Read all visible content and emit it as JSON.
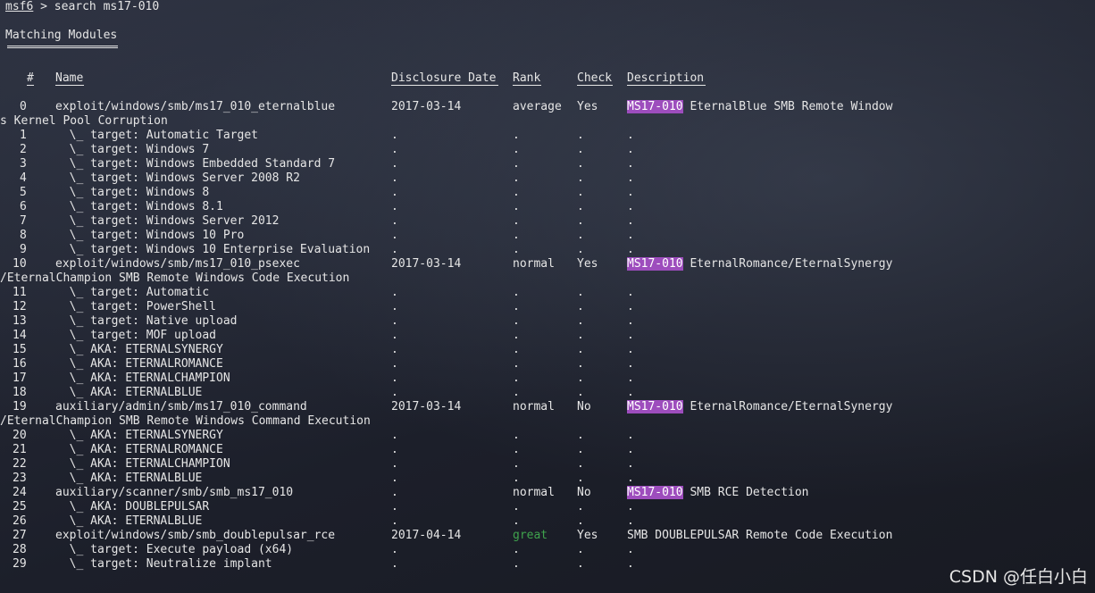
{
  "prompt": {
    "user": "msf6",
    "rest": " > search ms17-010"
  },
  "section_title": "Matching Modules",
  "columns": {
    "num": "#",
    "name": "Name",
    "date": "Disclosure Date",
    "rank": "Rank",
    "check": "Check",
    "desc": "Description"
  },
  "rows": [
    {
      "num": "0",
      "name": "exploit/windows/smb/ms17_010_eternalblue",
      "date": "2017-03-14",
      "rank": "average",
      "check": "Yes",
      "desc_hl": "MS17-010",
      "desc": " EternalBlue SMB Remote Window",
      "wrap": "s Kernel Pool Corruption"
    },
    {
      "num": "1",
      "name": "  \\_ target: Automatic Target",
      "date": ".",
      "rank": ".",
      "check": ".",
      "desc_hl": "",
      "desc": "."
    },
    {
      "num": "2",
      "name": "  \\_ target: Windows 7",
      "date": ".",
      "rank": ".",
      "check": ".",
      "desc_hl": "",
      "desc": "."
    },
    {
      "num": "3",
      "name": "  \\_ target: Windows Embedded Standard 7",
      "date": ".",
      "rank": ".",
      "check": ".",
      "desc_hl": "",
      "desc": "."
    },
    {
      "num": "4",
      "name": "  \\_ target: Windows Server 2008 R2",
      "date": ".",
      "rank": ".",
      "check": ".",
      "desc_hl": "",
      "desc": "."
    },
    {
      "num": "5",
      "name": "  \\_ target: Windows 8",
      "date": ".",
      "rank": ".",
      "check": ".",
      "desc_hl": "",
      "desc": "."
    },
    {
      "num": "6",
      "name": "  \\_ target: Windows 8.1",
      "date": ".",
      "rank": ".",
      "check": ".",
      "desc_hl": "",
      "desc": "."
    },
    {
      "num": "7",
      "name": "  \\_ target: Windows Server 2012",
      "date": ".",
      "rank": ".",
      "check": ".",
      "desc_hl": "",
      "desc": "."
    },
    {
      "num": "8",
      "name": "  \\_ target: Windows 10 Pro",
      "date": ".",
      "rank": ".",
      "check": ".",
      "desc_hl": "",
      "desc": "."
    },
    {
      "num": "9",
      "name": "  \\_ target: Windows 10 Enterprise Evaluation",
      "date": ".",
      "rank": ".",
      "check": ".",
      "desc_hl": "",
      "desc": "."
    },
    {
      "num": "10",
      "name": "exploit/windows/smb/ms17_010_psexec",
      "date": "2017-03-14",
      "rank": "normal",
      "check": "Yes",
      "desc_hl": "MS17-010",
      "desc": " EternalRomance/EternalSynergy",
      "wrap": "/EternalChampion SMB Remote Windows Code Execution"
    },
    {
      "num": "11",
      "name": "  \\_ target: Automatic",
      "date": ".",
      "rank": ".",
      "check": ".",
      "desc_hl": "",
      "desc": "."
    },
    {
      "num": "12",
      "name": "  \\_ target: PowerShell",
      "date": ".",
      "rank": ".",
      "check": ".",
      "desc_hl": "",
      "desc": "."
    },
    {
      "num": "13",
      "name": "  \\_ target: Native upload",
      "date": ".",
      "rank": ".",
      "check": ".",
      "desc_hl": "",
      "desc": "."
    },
    {
      "num": "14",
      "name": "  \\_ target: MOF upload",
      "date": ".",
      "rank": ".",
      "check": ".",
      "desc_hl": "",
      "desc": "."
    },
    {
      "num": "15",
      "name": "  \\_ AKA: ETERNALSYNERGY",
      "date": ".",
      "rank": ".",
      "check": ".",
      "desc_hl": "",
      "desc": "."
    },
    {
      "num": "16",
      "name": "  \\_ AKA: ETERNALROMANCE",
      "date": ".",
      "rank": ".",
      "check": ".",
      "desc_hl": "",
      "desc": "."
    },
    {
      "num": "17",
      "name": "  \\_ AKA: ETERNALCHAMPION",
      "date": ".",
      "rank": ".",
      "check": ".",
      "desc_hl": "",
      "desc": "."
    },
    {
      "num": "18",
      "name": "  \\_ AKA: ETERNALBLUE",
      "date": ".",
      "rank": ".",
      "check": ".",
      "desc_hl": "",
      "desc": "."
    },
    {
      "num": "19",
      "name": "auxiliary/admin/smb/ms17_010_command",
      "date": "2017-03-14",
      "rank": "normal",
      "check": "No",
      "desc_hl": "MS17-010",
      "desc": " EternalRomance/EternalSynergy",
      "wrap": "/EternalChampion SMB Remote Windows Command Execution"
    },
    {
      "num": "20",
      "name": "  \\_ AKA: ETERNALSYNERGY",
      "date": ".",
      "rank": ".",
      "check": ".",
      "desc_hl": "",
      "desc": "."
    },
    {
      "num": "21",
      "name": "  \\_ AKA: ETERNALROMANCE",
      "date": ".",
      "rank": ".",
      "check": ".",
      "desc_hl": "",
      "desc": "."
    },
    {
      "num": "22",
      "name": "  \\_ AKA: ETERNALCHAMPION",
      "date": ".",
      "rank": ".",
      "check": ".",
      "desc_hl": "",
      "desc": "."
    },
    {
      "num": "23",
      "name": "  \\_ AKA: ETERNALBLUE",
      "date": ".",
      "rank": ".",
      "check": ".",
      "desc_hl": "",
      "desc": "."
    },
    {
      "num": "24",
      "name": "auxiliary/scanner/smb/smb_ms17_010",
      "date": ".",
      "rank": "normal",
      "check": "No",
      "desc_hl": "MS17-010",
      "desc": " SMB RCE Detection"
    },
    {
      "num": "25",
      "name": "  \\_ AKA: DOUBLEPULSAR",
      "date": ".",
      "rank": ".",
      "check": ".",
      "desc_hl": "",
      "desc": "."
    },
    {
      "num": "26",
      "name": "  \\_ AKA: ETERNALBLUE",
      "date": ".",
      "rank": ".",
      "check": ".",
      "desc_hl": "",
      "desc": "."
    },
    {
      "num": "27",
      "name": "exploit/windows/smb/smb_doublepulsar_rce",
      "date": "2017-04-14",
      "rank": "great",
      "check": "Yes",
      "desc_hl": "",
      "desc": "SMB DOUBLEPULSAR Remote Code Execution"
    },
    {
      "num": "28",
      "name": "  \\_ target: Execute payload (x64)",
      "date": ".",
      "rank": ".",
      "check": ".",
      "desc_hl": "",
      "desc": "."
    },
    {
      "num": "29",
      "name": "  \\_ target: Neutralize implant",
      "date": ".",
      "rank": ".",
      "check": ".",
      "desc_hl": "",
      "desc": "."
    }
  ],
  "watermark": "CSDN @任白小白",
  "colors": {
    "highlight": "#9d4dbd",
    "rank_great": "#3fa34d",
    "text": "#e6e6e6"
  }
}
